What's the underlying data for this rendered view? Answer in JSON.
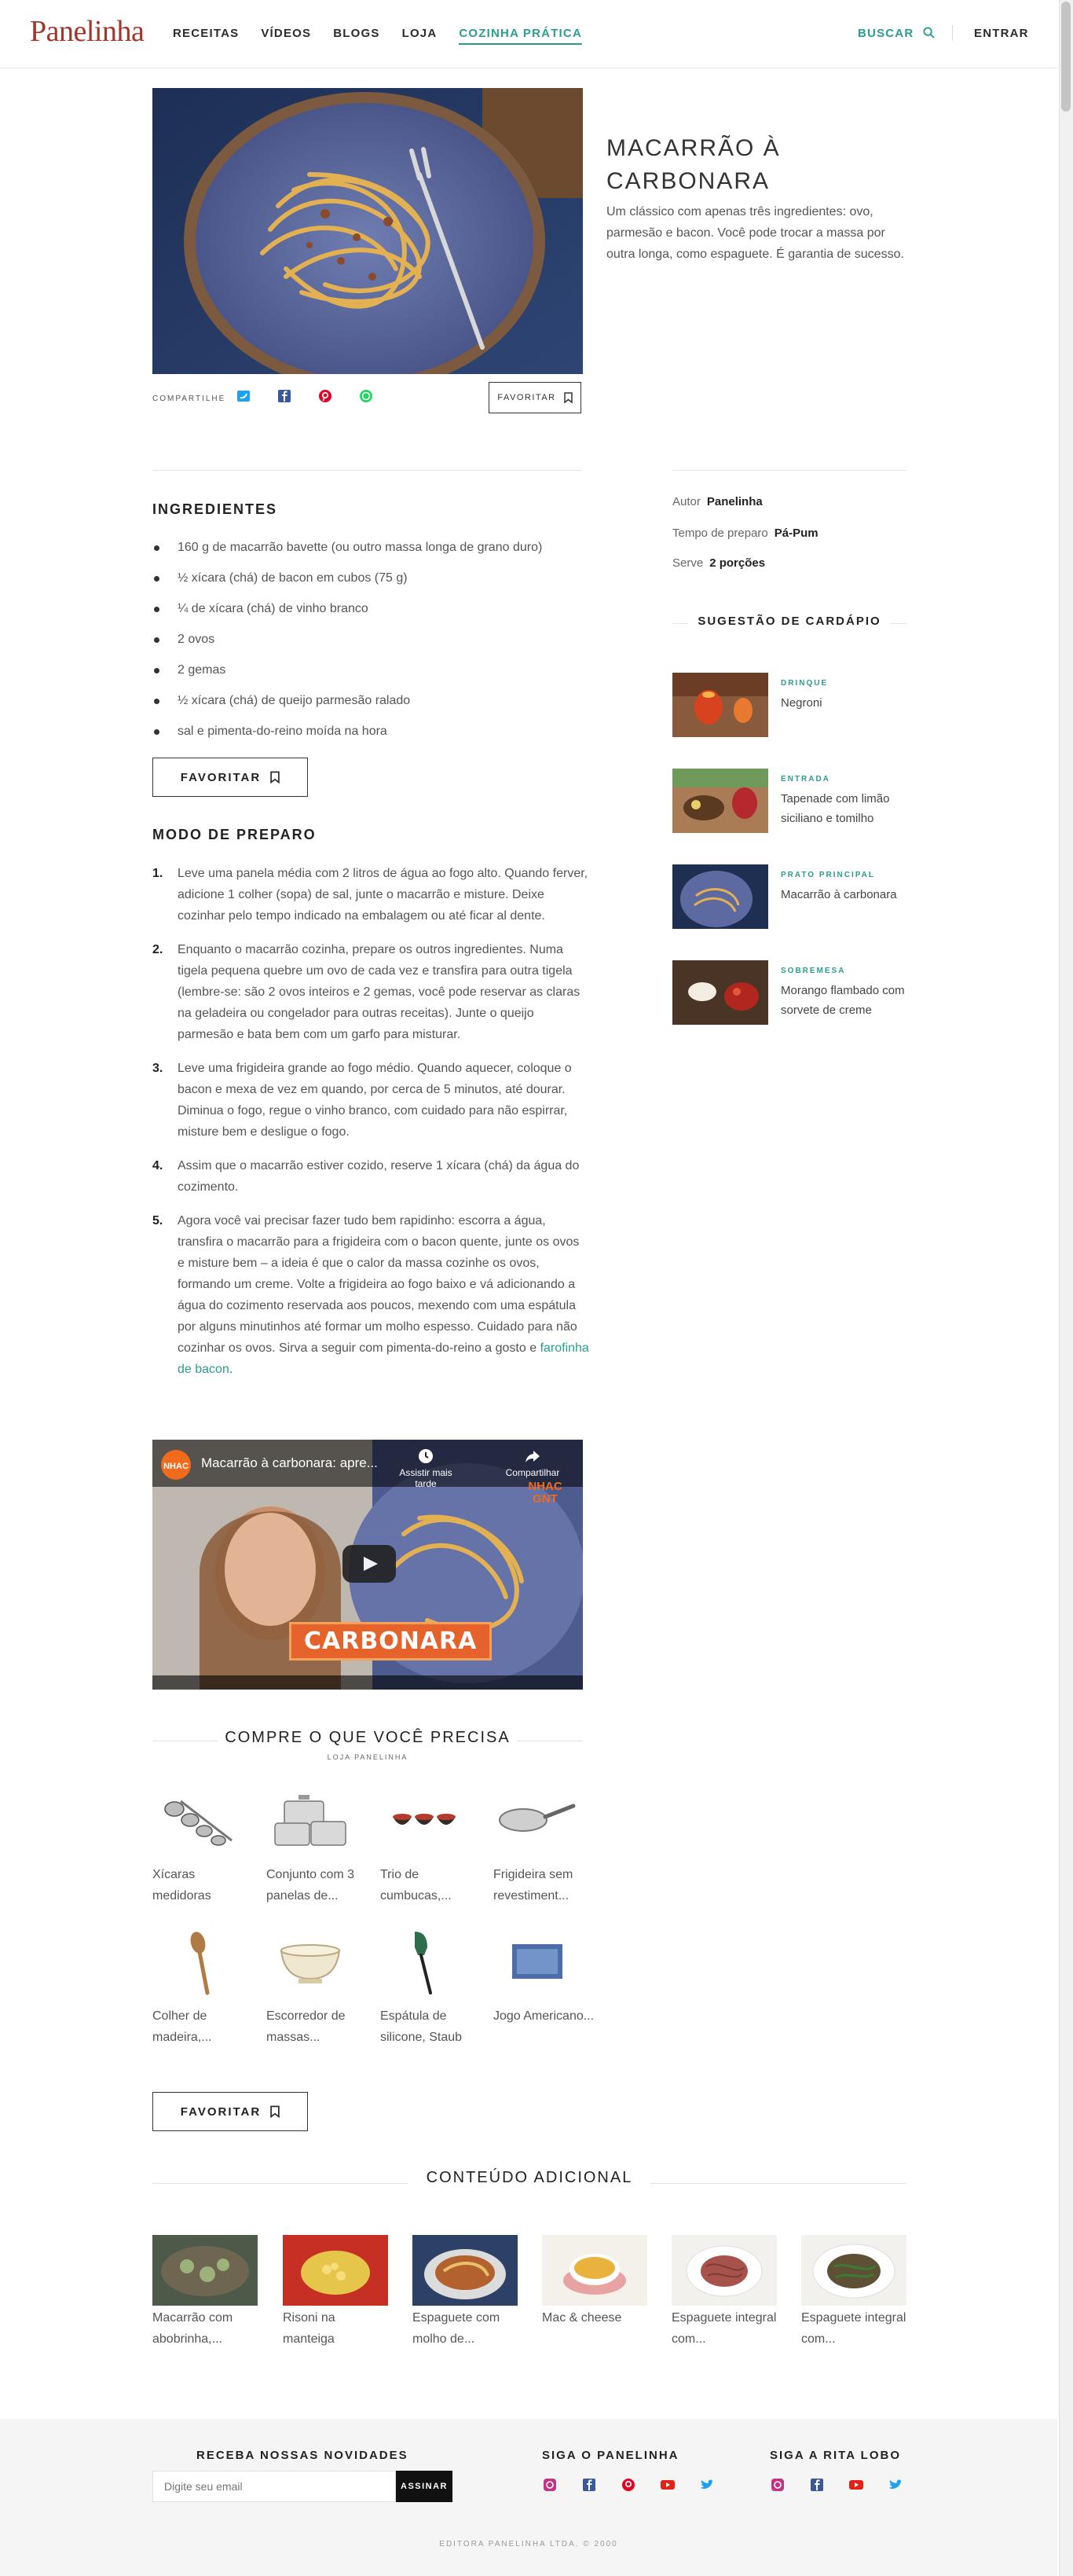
{
  "header": {
    "logo": "Panelinha",
    "nav": [
      "RECEITAS",
      "VÍDEOS",
      "BLOGS",
      "LOJA",
      "COZINHA PRÁTICA"
    ],
    "search_label": "BUSCAR",
    "login_label": "ENTRAR"
  },
  "recipe": {
    "title": "MACARRÃO À CARBONARA",
    "intro": "Um clássico com apenas três ingredientes: ovo, parmesão e bacon. Você pode trocar a massa por outra longa, como espaguete. É garantia de sucesso.",
    "share_label": "COMPARTILHE",
    "favorite_small": "FAVORITAR",
    "ingredients_title": "INGREDIENTES",
    "ingredients": [
      "160 g de macarrão bavette (ou outro massa longa de grano duro)",
      "½ xícara (chá) de bacon em cubos (75 g)",
      "¼ de xícara (chá) de vinho branco",
      "2 ovos",
      "2 gemas",
      "½ xícara (chá) de queijo parmesão ralado",
      "sal e pimenta-do-reino moída na hora"
    ],
    "favorite_button": "FAVORITAR",
    "method_title": "MODO DE PREPARO",
    "steps": [
      {
        "num": "1.",
        "text": "Leve uma panela média com 2 litros de água ao fogo alto. Quando ferver, adicione 1 colher (sopa) de sal, junte o macarrão e misture. Deixe cozinhar pelo tempo indicado na embalagem ou até ficar al dente."
      },
      {
        "num": "2.",
        "text": "Enquanto o macarrão cozinha, prepare os outros ingredientes. Numa tigela pequena quebre um ovo de cada vez e transfira para outra tigela (lembre-se: são 2 ovos inteiros e 2 gemas, você pode reservar as claras na geladeira ou congelador para outras receitas). Junte o queijo parmesão e bata bem com um garfo para misturar."
      },
      {
        "num": "3.",
        "text": "Leve uma frigideira grande ao fogo médio. Quando aquecer, coloque o bacon e mexa  de vez em quando, por cerca de 5 minutos, até dourar. Diminua o fogo, regue o vinho branco, com cuidado para não espirrar, misture bem e desligue o fogo."
      },
      {
        "num": "4.",
        "text": "Assim que o macarrão estiver cozido, reserve 1 xícara (chá) da água do cozimento."
      },
      {
        "num": "5.",
        "text": "Agora você vai precisar fazer tudo bem rapidinho: escorra a água, transfira o macarrão para a frigideira com o bacon quente, junte os ovos e misture bem – a ideia é que o calor da massa cozinhe os ovos, formando um creme. Volte a frigideira ao fogo baixo e vá adicionando a água do cozimento reservada aos poucos, mexendo com uma espátula por alguns minutinhos até formar um molho espesso. Cuidado para não cozinhar os ovos. Sirva a seguir com pimenta-do-reino a gosto e ",
        "link": "farofinha de bacon",
        "end": "."
      }
    ],
    "favorite_button_2": "FAVORITAR"
  },
  "video": {
    "title": "Macarrão à carbonara: apre...",
    "watch_later": "Assistir mais tarde",
    "share": "Compartilhar",
    "banner": "CARBONARA",
    "channel_badge": "NHAC GNT"
  },
  "shop": {
    "title": "COMPRE O QUE VOCÊ PRECISA",
    "subtitle": "LOJA PANELINHA",
    "items": [
      {
        "name": "Xícaras medidoras",
        "icon": "measuring-cups-icon"
      },
      {
        "name": "Conjunto com 3 panelas de...",
        "icon": "pan-set-icon"
      },
      {
        "name": "Trio de cumbucas,...",
        "icon": "bowls-icon"
      },
      {
        "name": "Frigideira sem revestiment...",
        "icon": "frying-pan-icon"
      },
      {
        "name": "Colher de madeira,...",
        "icon": "wooden-spoon-icon"
      },
      {
        "name": "Escorredor de massas...",
        "icon": "colander-icon"
      },
      {
        "name": "Espátula de silicone, Staub",
        "icon": "spatula-icon"
      },
      {
        "name": "Jogo Americano...",
        "icon": "placemat-icon"
      }
    ]
  },
  "extra": {
    "title": "CONTEÚDO ADICIONAL",
    "items": [
      "Macarrão com abobrinha,...",
      "Risoni na manteiga",
      "Espaguete com molho de...",
      "Mac & cheese",
      "Espaguete integral com...",
      "Espaguete integral com..."
    ]
  },
  "sidebar": {
    "author_label": "Autor",
    "author": "Panelinha",
    "time_label": "Tempo de preparo",
    "time": "Pá-Pum",
    "serves_label": "Serve",
    "serves": "2 porções",
    "suggestion_title": "SUGESTÃO DE CARDÁPIO",
    "suggestions": [
      {
        "category": "DRINQUE",
        "name": "Negroni"
      },
      {
        "category": "ENTRADA",
        "name": "Tapenade com limão siciliano e tomilho"
      },
      {
        "category": "PRATO PRINCIPAL",
        "name": "Macarrão à carbonara"
      },
      {
        "category": "SOBREMESA",
        "name": "Morango flambado com sorvete de creme"
      }
    ]
  },
  "footer": {
    "newsletter_title": "RECEBA NOSSAS NOVIDADES",
    "email_placeholder": "Digite seu email",
    "subscribe": "ASSINAR",
    "follow_panelinha": "SIGA O PANELINHA",
    "follow_rita": "SIGA A RITA LOBO",
    "copyright": "EDITORA PANELINHA LTDA. © 2000"
  },
  "colors": {
    "brand": "#a3352a",
    "accent": "#2a9d8f"
  }
}
